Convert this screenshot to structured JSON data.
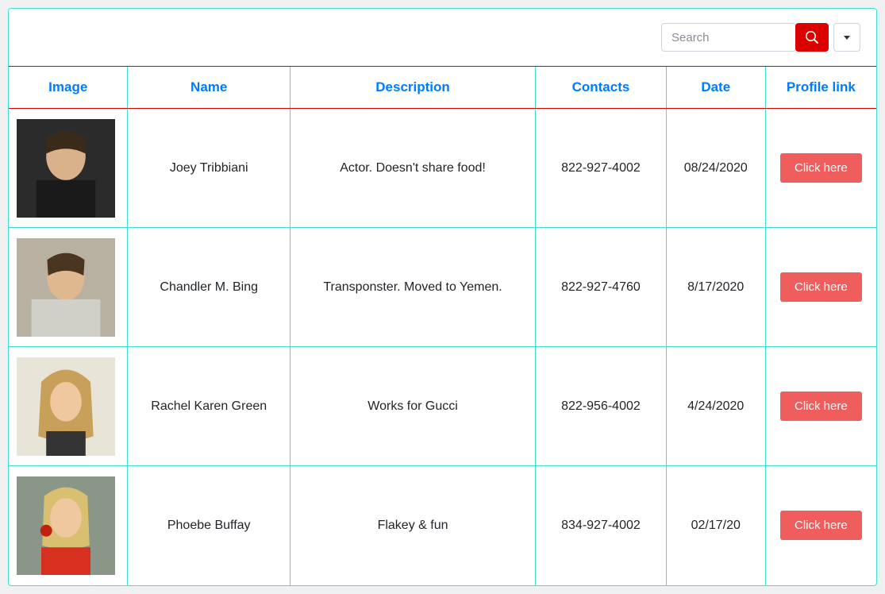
{
  "search": {
    "placeholder": "Search"
  },
  "columns": {
    "image": "Image",
    "name": "Name",
    "description": "Description",
    "contacts": "Contacts",
    "date": "Date",
    "profile_link": "Profile link"
  },
  "profile_button_label": "Click here",
  "rows": [
    {
      "name": "Joey Tribbiani",
      "description": "Actor. Doesn't share food!",
      "contacts": "822-927-4002",
      "date": "08/24/2020"
    },
    {
      "name": "Chandler M. Bing",
      "description": "Transponster. Moved to Yemen.",
      "contacts": "822-927-4760",
      "date": "8/17/2020"
    },
    {
      "name": "Rachel Karen Green",
      "description": "Works for Gucci",
      "contacts": "822-956-4002",
      "date": "4/24/2020"
    },
    {
      "name": "Phoebe Buffay",
      "description": "Flakey & fun",
      "contacts": "834-927-4002",
      "date": "02/17/20"
    }
  ]
}
